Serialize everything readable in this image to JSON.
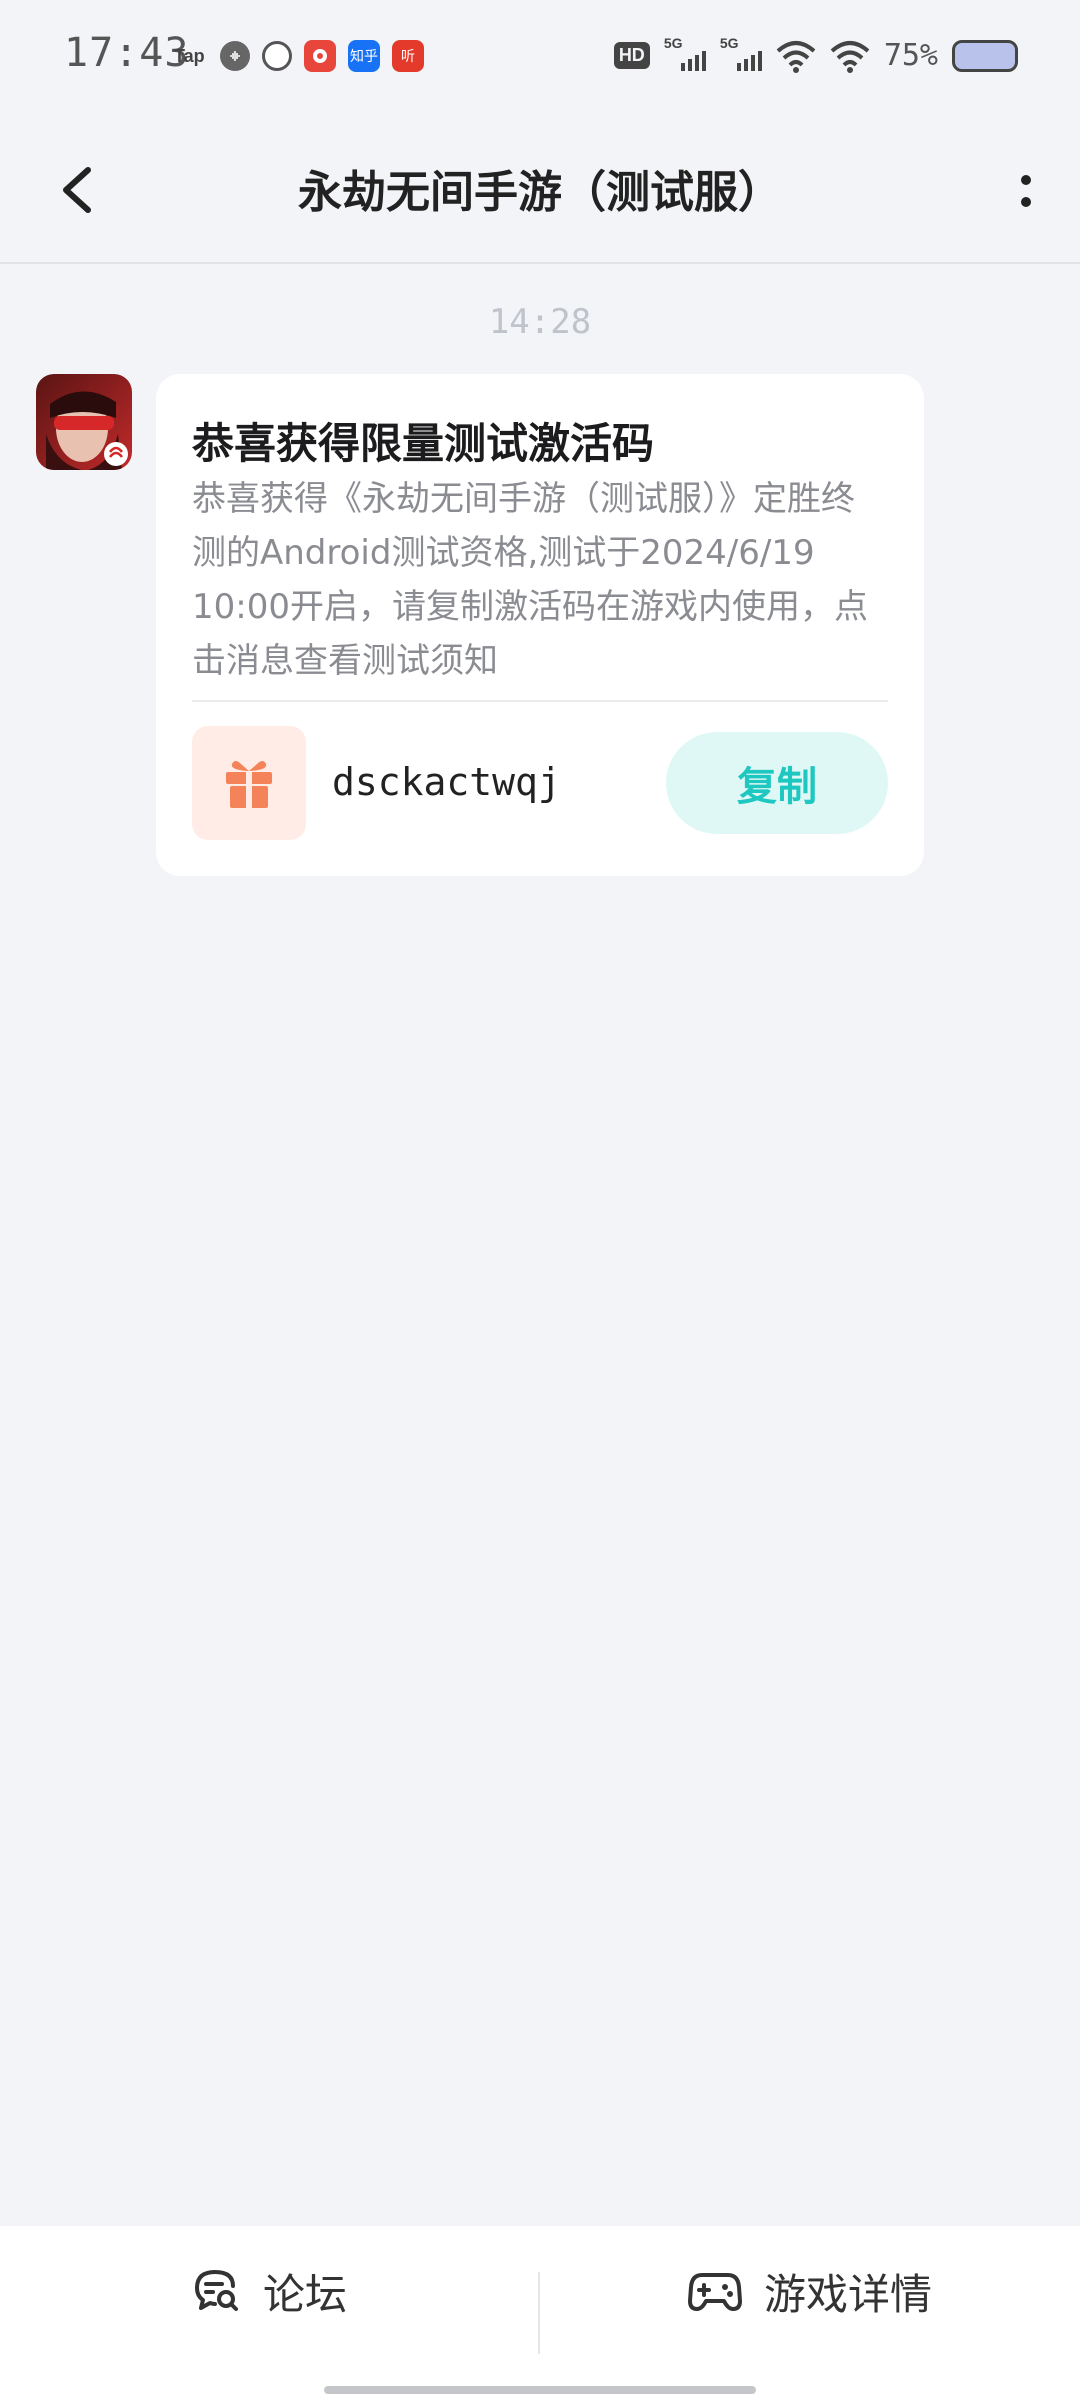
{
  "status_bar": {
    "time": "17:43",
    "tap_label": "Tap",
    "zhihu_label": "知乎",
    "ting_label": "听",
    "hd_label": "HD",
    "sim1_label": "5G",
    "sim2_label": "5G",
    "battery_percent": "75%"
  },
  "header": {
    "title": "永劫无间手游（测试服）"
  },
  "message": {
    "timestamp": "14:28",
    "title": "恭喜获得限量测试激活码",
    "body": "恭喜获得《永劫无间手游（测试服）》定胜终测的Android测试资格,测试于2024/6/19 10:00开启，请复制激活码在游戏内使用，点击消息查看测试须知",
    "code": "dsckactwqj",
    "copy_label": "复制"
  },
  "bottom_nav": {
    "forum_label": "论坛",
    "detail_label": "游戏详情"
  },
  "colors": {
    "accent": "#1ec7bf",
    "gift": "#f5835a",
    "background": "#f3f4f7"
  }
}
